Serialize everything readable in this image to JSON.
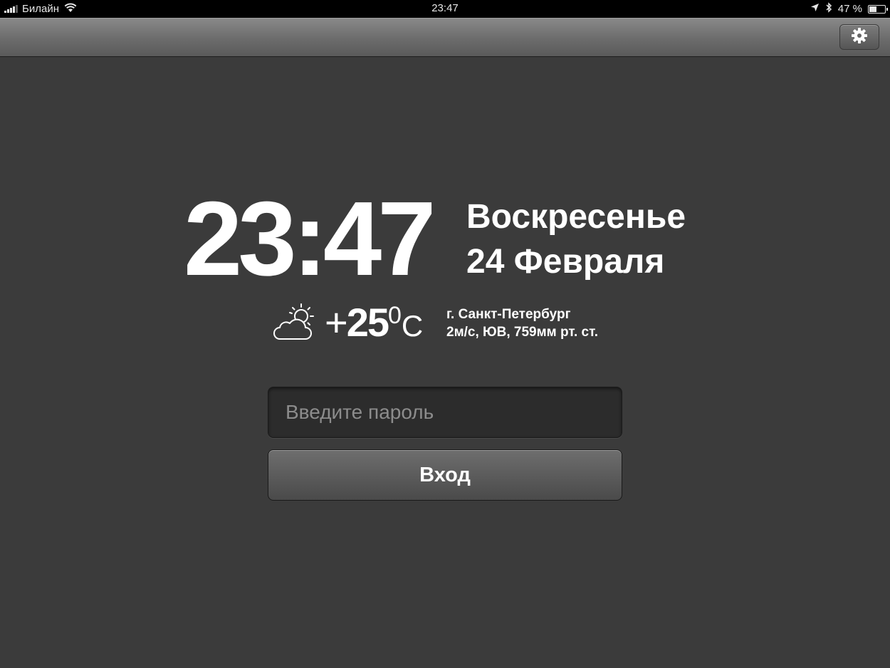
{
  "status_bar": {
    "carrier": "Билайн",
    "time": "23:47",
    "battery_percent": "47 %",
    "battery_level": 0.47,
    "icons": [
      "signal-icon",
      "wifi-icon",
      "location-icon",
      "bluetooth-icon",
      "battery-icon"
    ]
  },
  "toolbar": {
    "settings_icon": "gear-icon"
  },
  "clock": {
    "time": "23:47",
    "weekday": "Воскресенье",
    "date": "24 Февраля"
  },
  "weather": {
    "icon": "partly-cloudy-icon",
    "sign": "+",
    "temperature": "25",
    "degree": "0",
    "unit": "C",
    "city": "г. Санкт-Петербург",
    "details": "2м/с, ЮВ, 759мм рт. ст."
  },
  "login": {
    "password_value": "",
    "password_placeholder": "Введите пароль",
    "submit_label": "Вход"
  }
}
